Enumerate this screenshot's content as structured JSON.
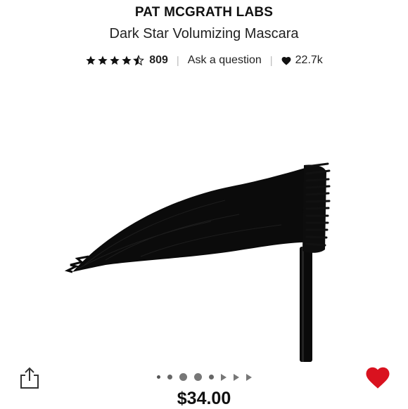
{
  "product": {
    "brand": "PAT MCGRATH LABS",
    "name": "Dark Star Volumizing Mascara",
    "review_count": "809",
    "ask_label": "Ask a question",
    "loves_count": "22.7k",
    "price": "$34.00",
    "rating": 4.5,
    "rating_max": 5
  },
  "colors": {
    "text": "#111111",
    "heart_active": "#d9121f",
    "separator": "#bbbbbb"
  },
  "carousel": {
    "total_items": 9,
    "active_index": 2
  },
  "icons": {
    "share": "share-icon",
    "heart_small": "heart-icon",
    "heart_love": "heart-filled-icon"
  }
}
